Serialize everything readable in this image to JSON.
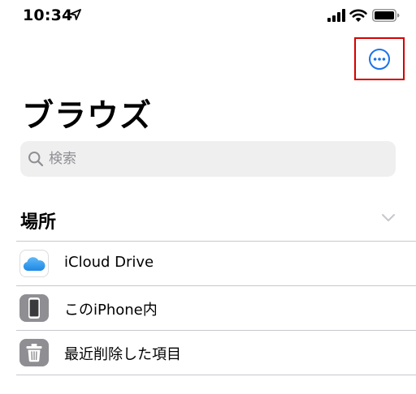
{
  "status_bar": {
    "time": "10:34"
  },
  "header": {
    "more_button_icon": "ellipsis-circle-icon",
    "title": "ブラウズ"
  },
  "search": {
    "placeholder": "検索"
  },
  "locations": {
    "section_title": "場所",
    "items": [
      {
        "label": "iCloud Drive",
        "icon": "icloud-icon"
      },
      {
        "label": "このiPhone内",
        "icon": "iphone-icon"
      },
      {
        "label": "最近削除した項目",
        "icon": "trash-icon"
      }
    ]
  },
  "colors": {
    "accent": "#1a73e8",
    "highlight_border": "#d50000",
    "search_background": "#efeff0",
    "separator": "#c8c7cc",
    "icon_gray": "#8e8e93"
  }
}
